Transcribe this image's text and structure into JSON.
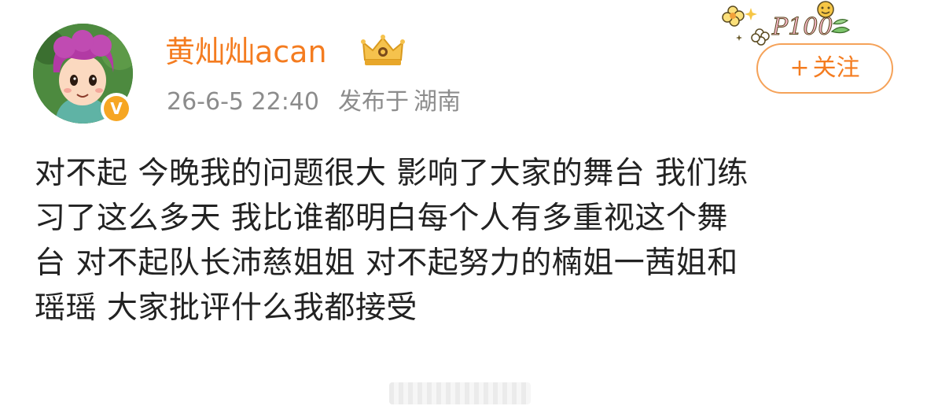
{
  "user": {
    "name": "黄灿灿acan",
    "verified_badge": "V",
    "timestamp": "26-6-5 22:40",
    "published_label": "发布于",
    "location": "湖南"
  },
  "follow_button": {
    "plus": "+",
    "label": "关注"
  },
  "decoration": {
    "text": "P100"
  },
  "post": {
    "lines": [
      "对不起 今晚我的问题很大 影响了大家的舞台 我们练",
      "习了这么多天 我比谁都明白每个人有多重视这个舞",
      "台 对不起队长沛慈姐姐 对不起努力的楠姐一茜姐和",
      "瑶瑶 大家批评什么我都接受"
    ]
  },
  "colors": {
    "accent": "#f47c20",
    "meta_text": "#8c8c8c",
    "body_text": "#222222",
    "badge": "#f6a623",
    "follow_border": "#f5a259"
  },
  "icons": {
    "crown": "crown-icon",
    "verified": "verified-badge-icon",
    "decoration": "flower-decoration-icon"
  }
}
